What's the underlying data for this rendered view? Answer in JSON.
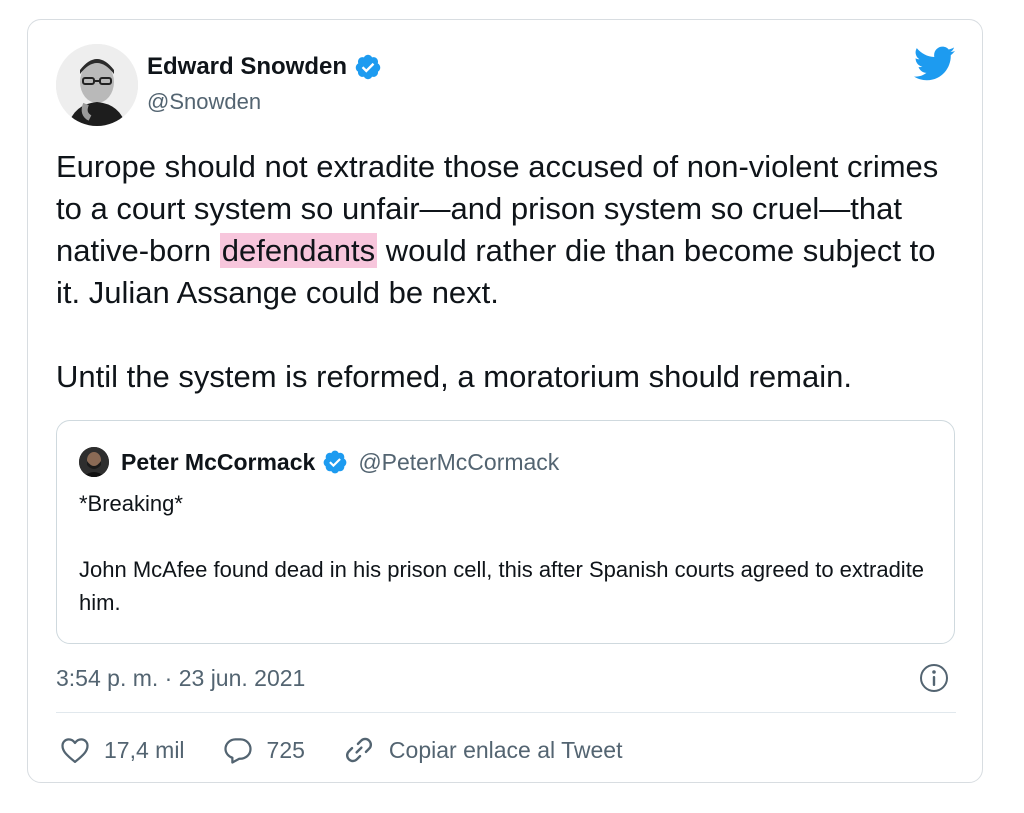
{
  "tweet": {
    "author_name": "Edward Snowden",
    "handle": "@Snowden",
    "text_part1": "Europe should not extradite those accused of non-violent crimes to a court system so unfair—and prison system so cruel—that native-born ",
    "highlighted_word": "defendants",
    "text_part2": " would rather die than become subject to it. Julian Assange could be next.",
    "text_paragraph2": "Until the system is reformed, a moratorium should remain.",
    "timestamp": "3:54 p. m. · 23 jun. 2021"
  },
  "quoted_tweet": {
    "author_name": "Peter McCormack",
    "handle": "@PeterMcCormack",
    "line1": "*Breaking*",
    "line2": "John McAfee found dead in his prison cell, this after Spanish courts agreed to extradite him."
  },
  "actions": {
    "like_count": "17,4 mil",
    "reply_count": "725",
    "copy_link_label": "Copiar enlace al Tweet"
  },
  "colors": {
    "twitter_blue": "#1d9bf0",
    "secondary_text": "#536471",
    "highlight": "#f7c6dc"
  },
  "icons": {
    "verified": "verified-badge-icon",
    "brand": "twitter-bird-icon",
    "like": "heart-icon",
    "reply": "speech-bubble-icon",
    "copy_link": "link-icon",
    "info": "info-icon"
  }
}
